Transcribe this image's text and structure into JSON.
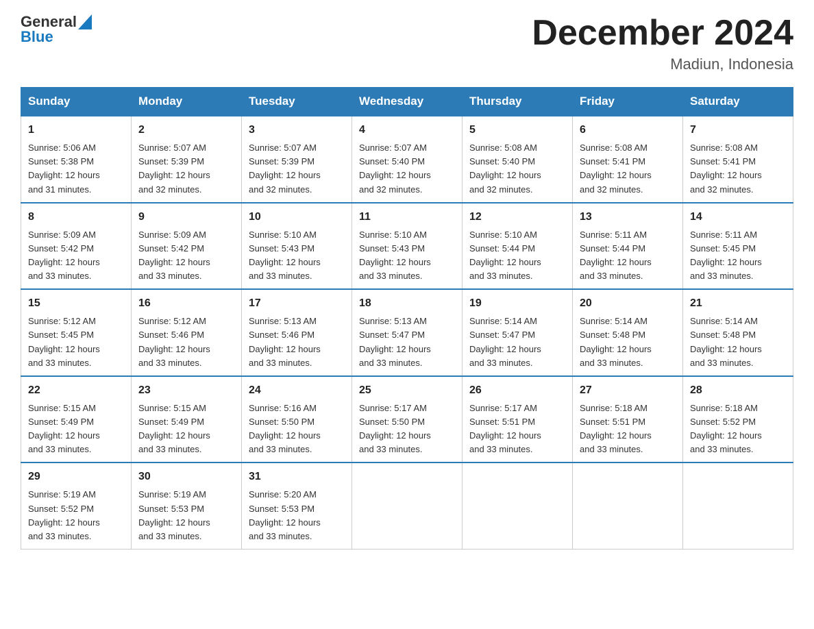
{
  "header": {
    "logo_general": "General",
    "logo_blue": "Blue",
    "month_title": "December 2024",
    "location": "Madiun, Indonesia"
  },
  "days_of_week": [
    "Sunday",
    "Monday",
    "Tuesday",
    "Wednesday",
    "Thursday",
    "Friday",
    "Saturday"
  ],
  "weeks": [
    [
      {
        "day": "1",
        "sunrise": "5:06 AM",
        "sunset": "5:38 PM",
        "daylight": "12 hours and 31 minutes."
      },
      {
        "day": "2",
        "sunrise": "5:07 AM",
        "sunset": "5:39 PM",
        "daylight": "12 hours and 32 minutes."
      },
      {
        "day": "3",
        "sunrise": "5:07 AM",
        "sunset": "5:39 PM",
        "daylight": "12 hours and 32 minutes."
      },
      {
        "day": "4",
        "sunrise": "5:07 AM",
        "sunset": "5:40 PM",
        "daylight": "12 hours and 32 minutes."
      },
      {
        "day": "5",
        "sunrise": "5:08 AM",
        "sunset": "5:40 PM",
        "daylight": "12 hours and 32 minutes."
      },
      {
        "day": "6",
        "sunrise": "5:08 AM",
        "sunset": "5:41 PM",
        "daylight": "12 hours and 32 minutes."
      },
      {
        "day": "7",
        "sunrise": "5:08 AM",
        "sunset": "5:41 PM",
        "daylight": "12 hours and 32 minutes."
      }
    ],
    [
      {
        "day": "8",
        "sunrise": "5:09 AM",
        "sunset": "5:42 PM",
        "daylight": "12 hours and 33 minutes."
      },
      {
        "day": "9",
        "sunrise": "5:09 AM",
        "sunset": "5:42 PM",
        "daylight": "12 hours and 33 minutes."
      },
      {
        "day": "10",
        "sunrise": "5:10 AM",
        "sunset": "5:43 PM",
        "daylight": "12 hours and 33 minutes."
      },
      {
        "day": "11",
        "sunrise": "5:10 AM",
        "sunset": "5:43 PM",
        "daylight": "12 hours and 33 minutes."
      },
      {
        "day": "12",
        "sunrise": "5:10 AM",
        "sunset": "5:44 PM",
        "daylight": "12 hours and 33 minutes."
      },
      {
        "day": "13",
        "sunrise": "5:11 AM",
        "sunset": "5:44 PM",
        "daylight": "12 hours and 33 minutes."
      },
      {
        "day": "14",
        "sunrise": "5:11 AM",
        "sunset": "5:45 PM",
        "daylight": "12 hours and 33 minutes."
      }
    ],
    [
      {
        "day": "15",
        "sunrise": "5:12 AM",
        "sunset": "5:45 PM",
        "daylight": "12 hours and 33 minutes."
      },
      {
        "day": "16",
        "sunrise": "5:12 AM",
        "sunset": "5:46 PM",
        "daylight": "12 hours and 33 minutes."
      },
      {
        "day": "17",
        "sunrise": "5:13 AM",
        "sunset": "5:46 PM",
        "daylight": "12 hours and 33 minutes."
      },
      {
        "day": "18",
        "sunrise": "5:13 AM",
        "sunset": "5:47 PM",
        "daylight": "12 hours and 33 minutes."
      },
      {
        "day": "19",
        "sunrise": "5:14 AM",
        "sunset": "5:47 PM",
        "daylight": "12 hours and 33 minutes."
      },
      {
        "day": "20",
        "sunrise": "5:14 AM",
        "sunset": "5:48 PM",
        "daylight": "12 hours and 33 minutes."
      },
      {
        "day": "21",
        "sunrise": "5:14 AM",
        "sunset": "5:48 PM",
        "daylight": "12 hours and 33 minutes."
      }
    ],
    [
      {
        "day": "22",
        "sunrise": "5:15 AM",
        "sunset": "5:49 PM",
        "daylight": "12 hours and 33 minutes."
      },
      {
        "day": "23",
        "sunrise": "5:15 AM",
        "sunset": "5:49 PM",
        "daylight": "12 hours and 33 minutes."
      },
      {
        "day": "24",
        "sunrise": "5:16 AM",
        "sunset": "5:50 PM",
        "daylight": "12 hours and 33 minutes."
      },
      {
        "day": "25",
        "sunrise": "5:17 AM",
        "sunset": "5:50 PM",
        "daylight": "12 hours and 33 minutes."
      },
      {
        "day": "26",
        "sunrise": "5:17 AM",
        "sunset": "5:51 PM",
        "daylight": "12 hours and 33 minutes."
      },
      {
        "day": "27",
        "sunrise": "5:18 AM",
        "sunset": "5:51 PM",
        "daylight": "12 hours and 33 minutes."
      },
      {
        "day": "28",
        "sunrise": "5:18 AM",
        "sunset": "5:52 PM",
        "daylight": "12 hours and 33 minutes."
      }
    ],
    [
      {
        "day": "29",
        "sunrise": "5:19 AM",
        "sunset": "5:52 PM",
        "daylight": "12 hours and 33 minutes."
      },
      {
        "day": "30",
        "sunrise": "5:19 AM",
        "sunset": "5:53 PM",
        "daylight": "12 hours and 33 minutes."
      },
      {
        "day": "31",
        "sunrise": "5:20 AM",
        "sunset": "5:53 PM",
        "daylight": "12 hours and 33 minutes."
      },
      null,
      null,
      null,
      null
    ]
  ],
  "labels": {
    "sunrise": "Sunrise:",
    "sunset": "Sunset:",
    "daylight": "Daylight:"
  }
}
